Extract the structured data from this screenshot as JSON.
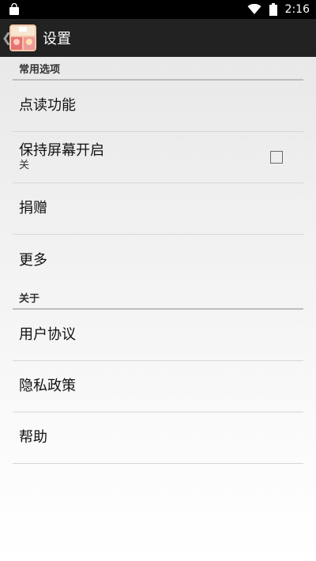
{
  "status_bar": {
    "time": "2:16",
    "icons": [
      "shopping-bag-icon",
      "wifi-icon",
      "battery-icon"
    ]
  },
  "action_bar": {
    "title": "设置",
    "up_icon": "chevron-left-icon",
    "app_icon": "app-logo-icon"
  },
  "sections": [
    {
      "header": "常用选项",
      "items": [
        {
          "title": "点读功能"
        },
        {
          "title": "保持屏幕开启",
          "summary": "关",
          "checkbox_checked": false
        },
        {
          "title": "捐赠"
        },
        {
          "title": "更多"
        }
      ]
    },
    {
      "header": "关于",
      "items": [
        {
          "title": "用户协议"
        },
        {
          "title": "隐私政策"
        },
        {
          "title": "帮助"
        }
      ]
    }
  ],
  "colors": {
    "status_bar": "#000000",
    "action_bar": "#222222",
    "divider": "#d6d6d6",
    "header_line": "#bdbdbd"
  }
}
